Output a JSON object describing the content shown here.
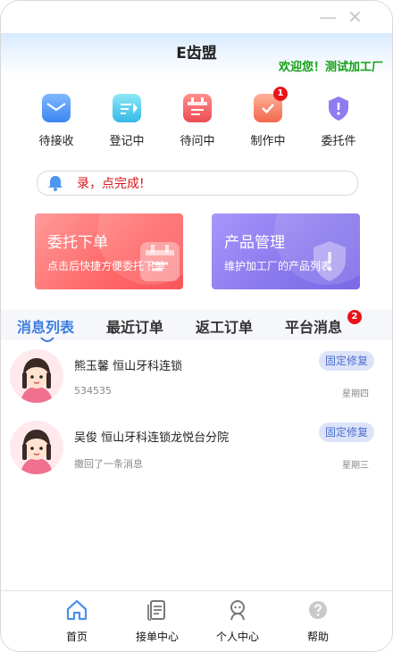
{
  "window": {
    "minimize_glyph": "—",
    "close_glyph": "✕"
  },
  "header": {
    "title": "E齿盟",
    "welcome": "欢迎您！测试加工厂"
  },
  "quick_actions": [
    {
      "label": "待接收",
      "icon": "inbox-icon"
    },
    {
      "label": "登记中",
      "icon": "register-icon"
    },
    {
      "label": "待问中",
      "icon": "calendar-icon"
    },
    {
      "label": "制作中",
      "icon": "task-check-icon",
      "badge": "1"
    },
    {
      "label": "委托件",
      "icon": "shield-icon"
    }
  ],
  "notice": {
    "text": "录，点完成!"
  },
  "cards": [
    {
      "title": "委托下单",
      "subtitle": "点击后快捷方便委托下单"
    },
    {
      "title": "产品管理",
      "subtitle": "维护加工厂的产品列表"
    }
  ],
  "tabs": [
    {
      "label": "消息列表"
    },
    {
      "label": "最近订单"
    },
    {
      "label": "返工订单"
    },
    {
      "label": "平台消息",
      "badge": "2"
    }
  ],
  "messages": [
    {
      "name": "熊玉馨 恒山牙科连锁",
      "preview": "534535",
      "tag": "固定修复",
      "day": "星期四"
    },
    {
      "name": "吴俊 恒山牙科连锁龙悦台分院",
      "preview": "撤回了一条消息",
      "day": "星期三",
      "tag": "固定修复"
    }
  ],
  "bottom_nav": [
    {
      "label": "首页",
      "icon": "home-icon"
    },
    {
      "label": "接单中心",
      "icon": "order-icon"
    },
    {
      "label": "个人中心",
      "icon": "user-icon"
    },
    {
      "label": "帮助",
      "icon": "help-icon"
    }
  ],
  "colors": {
    "accent": "#3c7de1",
    "welcome": "#12a012",
    "badge": "#e8141a",
    "alert_text": "#d9141a"
  }
}
